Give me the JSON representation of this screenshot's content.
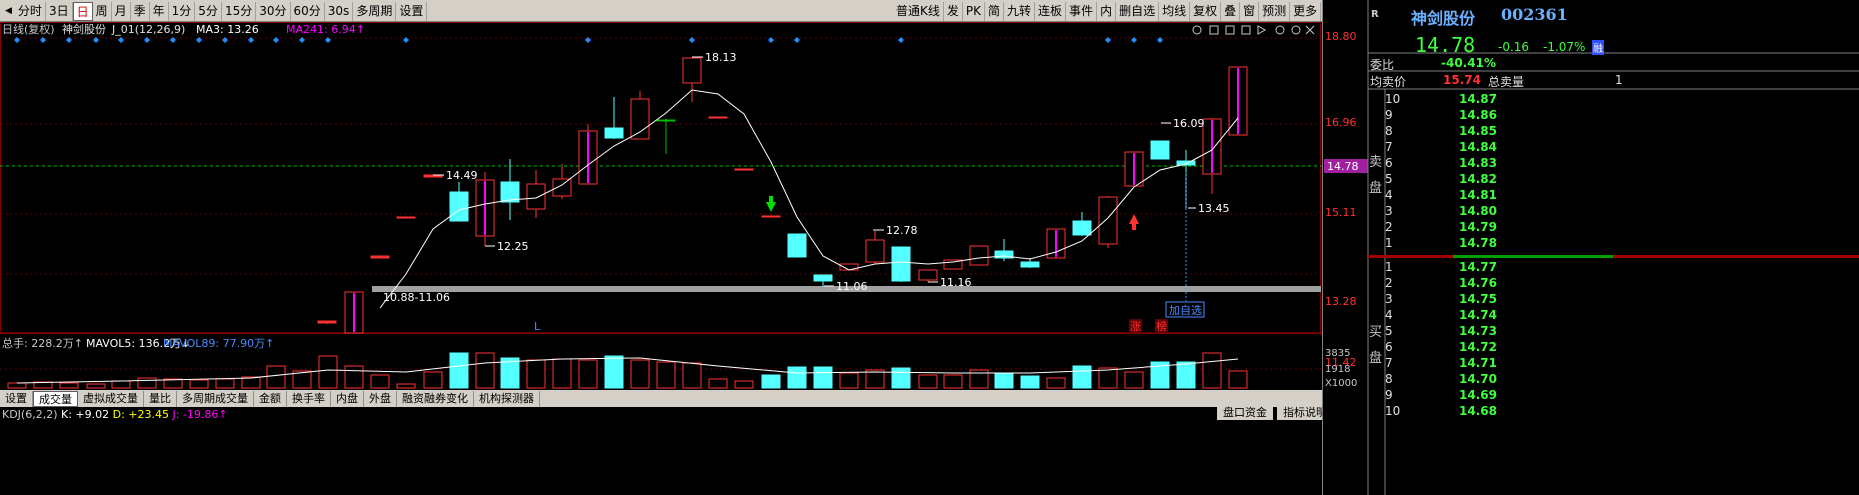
{
  "toolbar": {
    "left": [
      "分时",
      "3日",
      "日",
      "周",
      "月",
      "季",
      "年",
      "1分",
      "5分",
      "15分",
      "30分",
      "60分",
      "30s",
      "多周期",
      "设置"
    ],
    "active": "日",
    "right": [
      "普通K线",
      "发",
      "PK",
      "简",
      "九转",
      "连板",
      "事件",
      "内",
      "删自选",
      "均线",
      "复权",
      "叠",
      "窗",
      "预测",
      "更多"
    ]
  },
  "header": {
    "title": "日线(复权)",
    "stock": "神剑股份",
    "indicator": "J_01(12,26,9)",
    "ma3": "MA3: 13.26",
    "ma241": "MA241: 6.94↑"
  },
  "price_axis": [
    "18.80",
    "16.96",
    "15.11",
    "13.28",
    "11.42"
  ],
  "current_price_tag": "14.78",
  "annotations": {
    "high": "18.13",
    "h2": "14.49",
    "l1": "12.25",
    "h3": "12.78",
    "l2": "11.06",
    "l3": "11.16",
    "h4": "16.09",
    "l4": "13.45",
    "range_label": "10.88-11.06",
    "add_watch": "加自选",
    "L_marker": "L",
    "zhang": "涨",
    "bang": "榜"
  },
  "volume": {
    "title": "总手: 228.2万↑",
    "mavol5": "MAVOL5: 136.2万↓",
    "mavol89": "MAVOL89: 77.90万↑",
    "axis": [
      "3835",
      "1918",
      "X1000"
    ]
  },
  "tabs": [
    "设置",
    "成交量",
    "虚拟成交量",
    "量比",
    "多周期成交量",
    "金额",
    "换手率",
    "内盘",
    "外盘",
    "融资融券变化",
    "机构探测器"
  ],
  "active_tab": "成交量",
  "kdj": {
    "label": "KDJ(6,2,2)",
    "k": "K: +9.02",
    "d": "D: +23.45",
    "j": "J: -19.86↑"
  },
  "right_tabs": [
    "盘口资金",
    "指标说明"
  ],
  "quote": {
    "r_label": "R",
    "name": "神剑股份",
    "code": "002361",
    "price": "14.78",
    "change": "-0.16",
    "change_pct": "-1.07%",
    "badge": "融",
    "weibi_label": "委比",
    "weibi": "-40.41%",
    "avg_ask_label": "均卖价",
    "avg_ask": "15.74",
    "total_ask_label": "总卖量",
    "total_ask": "1"
  },
  "sell_side_label": "卖\n盘",
  "buy_side_label": "买\n盘",
  "asks": [
    {
      "level": "10",
      "price": "14.87"
    },
    {
      "level": "9",
      "price": "14.86"
    },
    {
      "level": "8",
      "price": "14.85"
    },
    {
      "level": "7",
      "price": "14.84"
    },
    {
      "level": "6",
      "price": "14.83"
    },
    {
      "level": "5",
      "price": "14.82"
    },
    {
      "level": "4",
      "price": "14.81"
    },
    {
      "level": "3",
      "price": "14.80"
    },
    {
      "level": "2",
      "price": "14.79"
    },
    {
      "level": "1",
      "price": "14.78"
    }
  ],
  "bids": [
    {
      "level": "1",
      "price": "14.77"
    },
    {
      "level": "2",
      "price": "14.76"
    },
    {
      "level": "3",
      "price": "14.75"
    },
    {
      "level": "4",
      "price": "14.74"
    },
    {
      "level": "5",
      "price": "14.73"
    },
    {
      "level": "6",
      "price": "14.72"
    },
    {
      "level": "7",
      "price": "14.71"
    },
    {
      "level": "8",
      "price": "14.70"
    },
    {
      "level": "9",
      "price": "14.69"
    },
    {
      "level": "10",
      "price": "14.68"
    }
  ],
  "colors": {
    "up": "#ff3232",
    "down": "#54ffff",
    "magenta": "#ff00ff",
    "ma": "#ffffff",
    "bid": "#3dff3d",
    "blue_marker": "#1e90ff"
  }
}
